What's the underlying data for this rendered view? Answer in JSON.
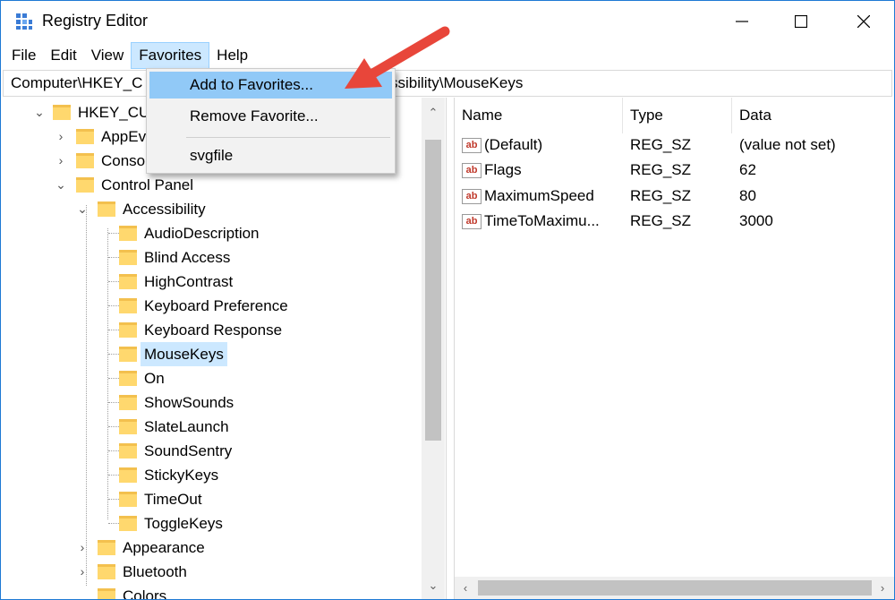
{
  "window": {
    "title": "Registry Editor"
  },
  "menubar": {
    "items": [
      "File",
      "Edit",
      "View",
      "Favorites",
      "Help"
    ],
    "active": "Favorites"
  },
  "address": {
    "path_left": "Computer\\HKEY_C",
    "path_right": "ssibility\\MouseKeys"
  },
  "favorites_menu": {
    "items": [
      "Add to Favorites...",
      "Remove Favorite...",
      "svgfile"
    ],
    "highlighted": "Add to Favorites..."
  },
  "tree": {
    "root": "HKEY_CU",
    "level1": [
      "AppEv",
      "Conso",
      "Control Panel"
    ],
    "control_panel_child": "Accessibility",
    "accessibility_children": [
      "AudioDescription",
      "Blind Access",
      "HighContrast",
      "Keyboard Preference",
      "Keyboard Response",
      "MouseKeys",
      "On",
      "ShowSounds",
      "SlateLaunch",
      "SoundSentry",
      "StickyKeys",
      "TimeOut",
      "ToggleKeys"
    ],
    "selected": "MouseKeys",
    "control_panel_siblings": [
      "Appearance",
      "Bluetooth",
      "Colors"
    ]
  },
  "values": {
    "columns": [
      "Name",
      "Type",
      "Data"
    ],
    "rows": [
      {
        "name": "(Default)",
        "type": "REG_SZ",
        "data": "(value not set)"
      },
      {
        "name": "Flags",
        "type": "REG_SZ",
        "data": "62"
      },
      {
        "name": "MaximumSpeed",
        "type": "REG_SZ",
        "data": "80"
      },
      {
        "name": "TimeToMaximu...",
        "type": "REG_SZ",
        "data": "3000"
      }
    ],
    "icon_text": "ab"
  },
  "colors": {
    "accent": "#1e79d4",
    "menu_highlight": "#91c9f7",
    "selection": "#cce8ff",
    "folder": "#ffd86e",
    "arrow": "#e8463a"
  }
}
